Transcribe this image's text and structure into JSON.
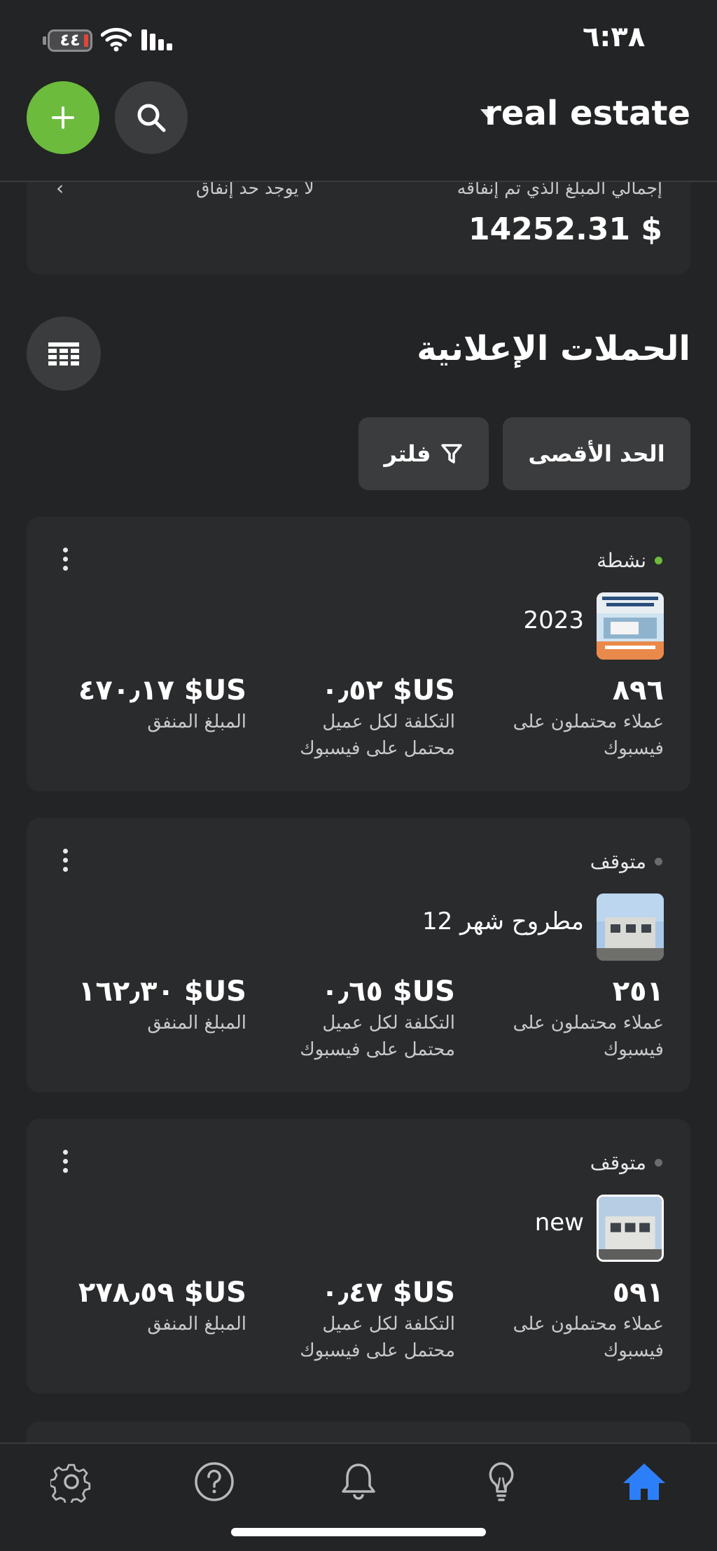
{
  "status_bar": {
    "time": "٦:٣٨",
    "battery": "٤٤"
  },
  "header": {
    "account_name": "real estate"
  },
  "spend_summary": {
    "total_label": "إجمالي المبلغ الذي تم إنفاقه",
    "total_value": "14252.31 $",
    "limit_label": "لا يوجد حد إنفاق"
  },
  "campaigns_section": {
    "title": "الحملات الإعلانية",
    "max_button": "الحد الأقصى",
    "filter_button": "فلتر"
  },
  "campaigns": [
    {
      "status": "نشطة",
      "status_color": "#6cbb3c",
      "name": "2023",
      "leads_value": "٨٩٦",
      "leads_label": "عملاء محتملون على فيسبوك",
      "cpl_value": "US$ ٠٫٥٢",
      "cpl_label": "التكلفة لكل عميل محتمل على فيسبوك",
      "spent_value": "US$ ٤٧٠٫١٧",
      "spent_label": "المبلغ المنفق"
    },
    {
      "status": "متوقف",
      "status_color": "#6b6c6e",
      "name": "مطروح شهر 12",
      "leads_value": "٢٥١",
      "leads_label": "عملاء محتملون على فيسبوك",
      "cpl_value": "US$ ٠٫٦٥",
      "cpl_label": "التكلفة لكل عميل محتمل على فيسبوك",
      "spent_value": "US$ ١٦٢٫٣٠",
      "spent_label": "المبلغ المنفق"
    },
    {
      "status": "متوقف",
      "status_color": "#6b6c6e",
      "name": "new",
      "leads_value": "٥٩١",
      "leads_label": "عملاء محتملون على فيسبوك",
      "cpl_value": "US$ ٠٫٤٧",
      "cpl_label": "التكلفة لكل عميل محتمل على فيسبوك",
      "spent_value": "US$ ٢٧٨٫٥٩",
      "spent_label": "المبلغ المنفق"
    }
  ],
  "tabbar": {
    "items": [
      "gear-icon",
      "help-icon",
      "bell-icon",
      "lightbulb-icon",
      "home-icon"
    ],
    "active": "home-icon",
    "active_color": "#2d7ff9"
  }
}
